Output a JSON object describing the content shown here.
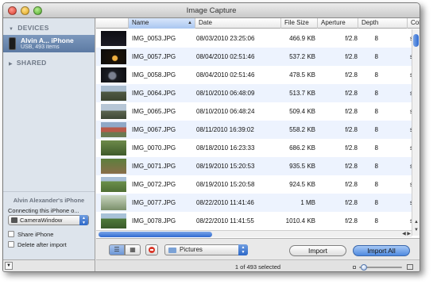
{
  "window": {
    "title": "Image Capture"
  },
  "sidebar": {
    "devices_header": "DEVICES",
    "shared_header": "SHARED",
    "device": {
      "name": "Alvin A... iPhone",
      "subtitle": "USB, 493 items"
    },
    "panel": {
      "title": "Alvin Alexander's iPhone",
      "connecting_label": "Connecting this iPhone o...",
      "app_popup_value": "CameraWindow",
      "share_checkbox_label": "Share iPhone",
      "delete_checkbox_label": "Delete after import"
    }
  },
  "table": {
    "columns": [
      "Name",
      "Date",
      "File Size",
      "Aperture",
      "Depth",
      "Colo"
    ],
    "sorted_column": "Name",
    "rows": [
      {
        "name": "IMG_0053.JPG",
        "date": "08/03/2010 23:25:06",
        "size": "466.9 KB",
        "aperture": "f/2.8",
        "depth": "8",
        "color": "s"
      },
      {
        "name": "IMG_0057.JPG",
        "date": "08/04/2010 02:51:46",
        "size": "537.2 KB",
        "aperture": "f/2.8",
        "depth": "8",
        "color": "s"
      },
      {
        "name": "IMG_0058.JPG",
        "date": "08/04/2010 02:51:46",
        "size": "478.5 KB",
        "aperture": "f/2.8",
        "depth": "8",
        "color": "s"
      },
      {
        "name": "IMG_0064.JPG",
        "date": "08/10/2010 06:48:09",
        "size": "513.7 KB",
        "aperture": "f/2.8",
        "depth": "8",
        "color": "s"
      },
      {
        "name": "IMG_0065.JPG",
        "date": "08/10/2010 06:48:24",
        "size": "509.4 KB",
        "aperture": "f/2.8",
        "depth": "8",
        "color": "s"
      },
      {
        "name": "IMG_0067.JPG",
        "date": "08/11/2010 16:39:02",
        "size": "558.2 KB",
        "aperture": "f/2.8",
        "depth": "8",
        "color": "s"
      },
      {
        "name": "IMG_0070.JPG",
        "date": "08/18/2010 16:23:33",
        "size": "686.2 KB",
        "aperture": "f/2.8",
        "depth": "8",
        "color": "s"
      },
      {
        "name": "IMG_0071.JPG",
        "date": "08/19/2010 15:20:53",
        "size": "935.5 KB",
        "aperture": "f/2.8",
        "depth": "8",
        "color": "s"
      },
      {
        "name": "IMG_0072.JPG",
        "date": "08/19/2010 15:20:58",
        "size": "924.5 KB",
        "aperture": "f/2.8",
        "depth": "8",
        "color": "s"
      },
      {
        "name": "IMG_0077.JPG",
        "date": "08/22/2010 11:41:46",
        "size": "1 MB",
        "aperture": "f/2.8",
        "depth": "8",
        "color": "s"
      },
      {
        "name": "IMG_0078.JPG",
        "date": "08/22/2010 11:41:55",
        "size": "1010.4 KB",
        "aperture": "f/2.8",
        "depth": "8",
        "color": "s"
      }
    ]
  },
  "toolbar": {
    "destination_popup_value": "Pictures",
    "import_label": "Import",
    "import_all_label": "Import All"
  },
  "status": {
    "text": "1 of 493 selected"
  },
  "colors": {
    "accent": "#3d74cf",
    "sidebar_bg": "#dde4ec",
    "selection": "#6586b0",
    "row_alt": "#edf3fe"
  },
  "icons": {
    "list_view": "list-view-icon",
    "grid_view": "grid-view-icon",
    "delete": "delete-icon",
    "folder": "folder-icon",
    "device": "iphone-icon"
  }
}
